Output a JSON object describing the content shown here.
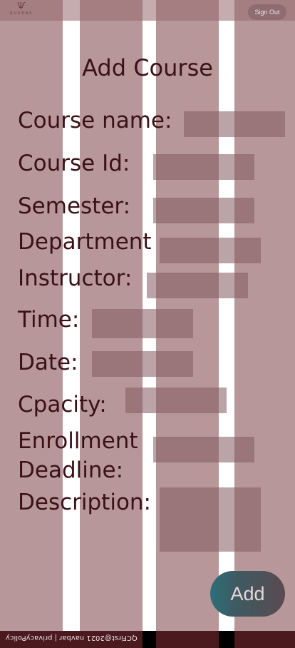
{
  "header": {
    "logo_text": "QUEENS",
    "signout_label": "Sign Out"
  },
  "form": {
    "title": "Add Course",
    "fields": {
      "course_name": "Course name:",
      "course_id": "Course Id:",
      "semester": "Semester:",
      "department": "Department",
      "instructor": "Instructor:",
      "time": "Time:",
      "date": "Date:",
      "capacity": "Cpacity:",
      "enrollment_line1": "Enrollment",
      "enrollment_line2": "Deadline:",
      "description": "Description:"
    },
    "add_label": "Add"
  },
  "footer": {
    "text": "QCFirst@2021 navbar | privacyPolicy"
  }
}
